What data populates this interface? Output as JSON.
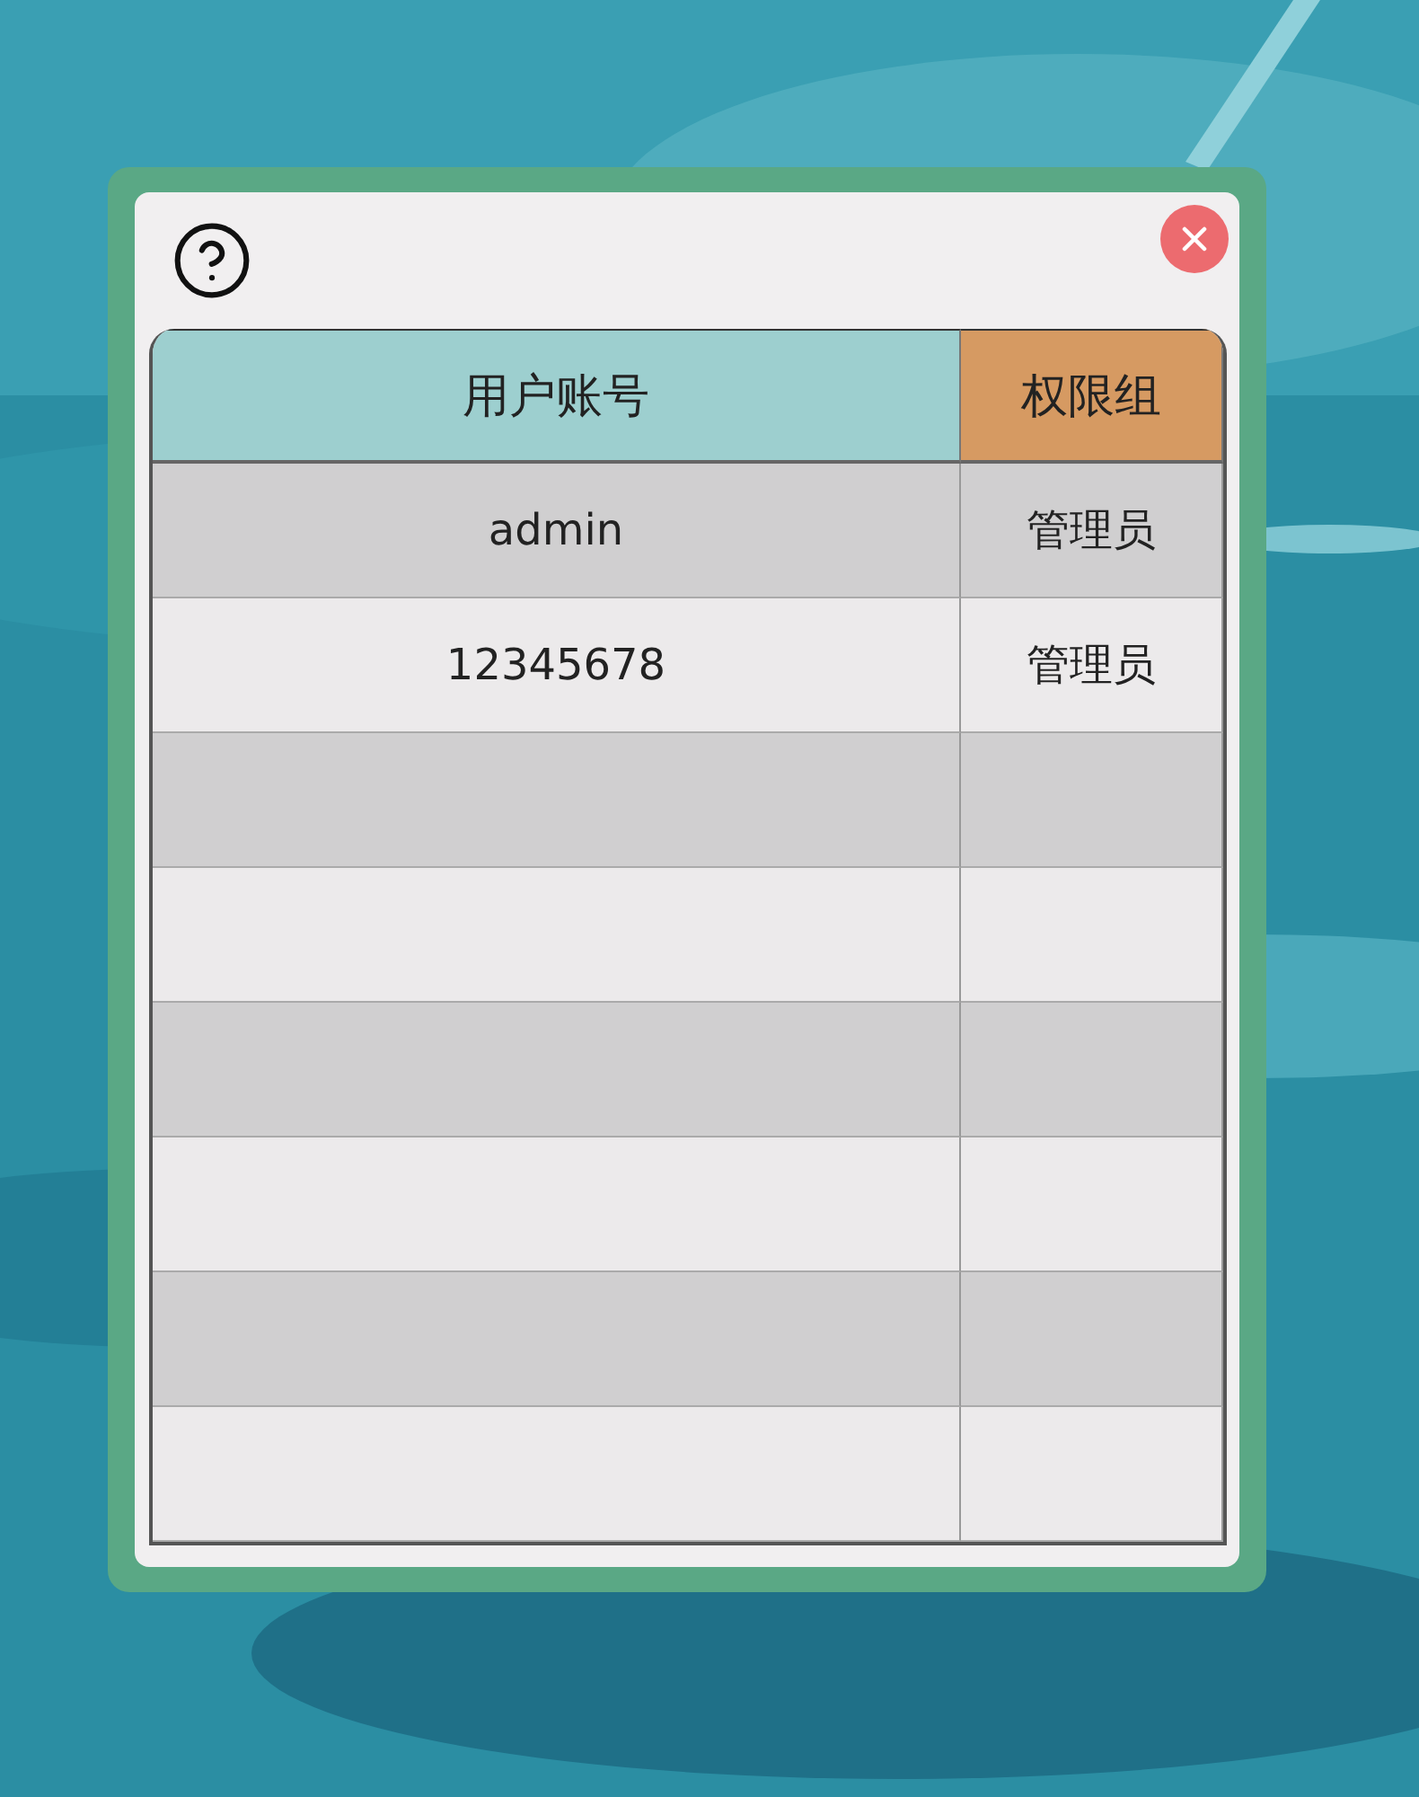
{
  "dialog": {
    "columns": [
      {
        "label": "用户账号",
        "color": "#9dcfcf"
      },
      {
        "label": "权限组",
        "color": "#d69a62"
      }
    ],
    "rows": [
      {
        "cells": [
          "admin",
          "管理员"
        ]
      },
      {
        "cells": [
          "12345678",
          "管理员"
        ]
      }
    ]
  }
}
